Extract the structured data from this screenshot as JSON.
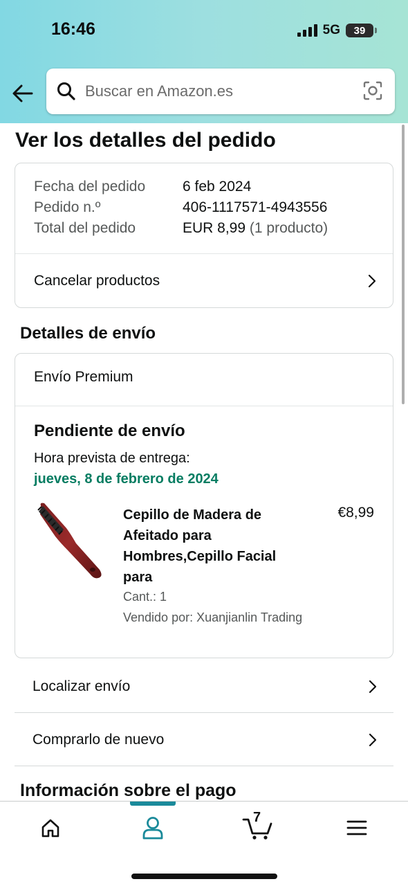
{
  "status_bar": {
    "time": "16:46",
    "network": "5G",
    "battery": "39"
  },
  "header": {
    "search_placeholder": "Buscar en Amazon.es",
    "back_icon": "arrow-left-icon",
    "camera_icon": "camera-scan-icon"
  },
  "page": {
    "title": "Ver los detalles del pedido"
  },
  "order_summary": {
    "date_label": "Fecha del pedido",
    "date_value": "6 feb 2024",
    "number_label": "Pedido n.º",
    "number_value": "406-1117571-4943556",
    "total_label": "Total del pedido",
    "total_value": "EUR 8,99",
    "total_count": "(1 producto)",
    "cancel_label": "Cancelar productos"
  },
  "shipping": {
    "section_title": "Detalles de envío",
    "shipping_type": "Envío Premium",
    "status": "Pendiente de envío",
    "eta_label": "Hora prevista de entrega:",
    "eta_date": "jueves, 8 de febrero de 2024",
    "product": {
      "name": "Cepillo de Madera de Afeitado para Hombres,Cepillo Facial para",
      "price": "€8,99",
      "qty": "Cant.: 1",
      "seller": "Vendido por: Xuanjianlin Trading"
    }
  },
  "actions": {
    "track_label": "Localizar envío",
    "buy_again_label": "Comprarlo de nuevo"
  },
  "payment": {
    "section_title": "Información sobre el pago"
  },
  "bottom_nav": {
    "items": [
      "home-icon",
      "account-icon",
      "cart-icon",
      "menu-icon"
    ],
    "cart_count": "7",
    "active_color": "#1a8a9a"
  },
  "colors": {
    "delivery_green": "#067d62",
    "header_gradient_start": "#82d8e3",
    "header_gradient_end": "#a6e4d5"
  }
}
